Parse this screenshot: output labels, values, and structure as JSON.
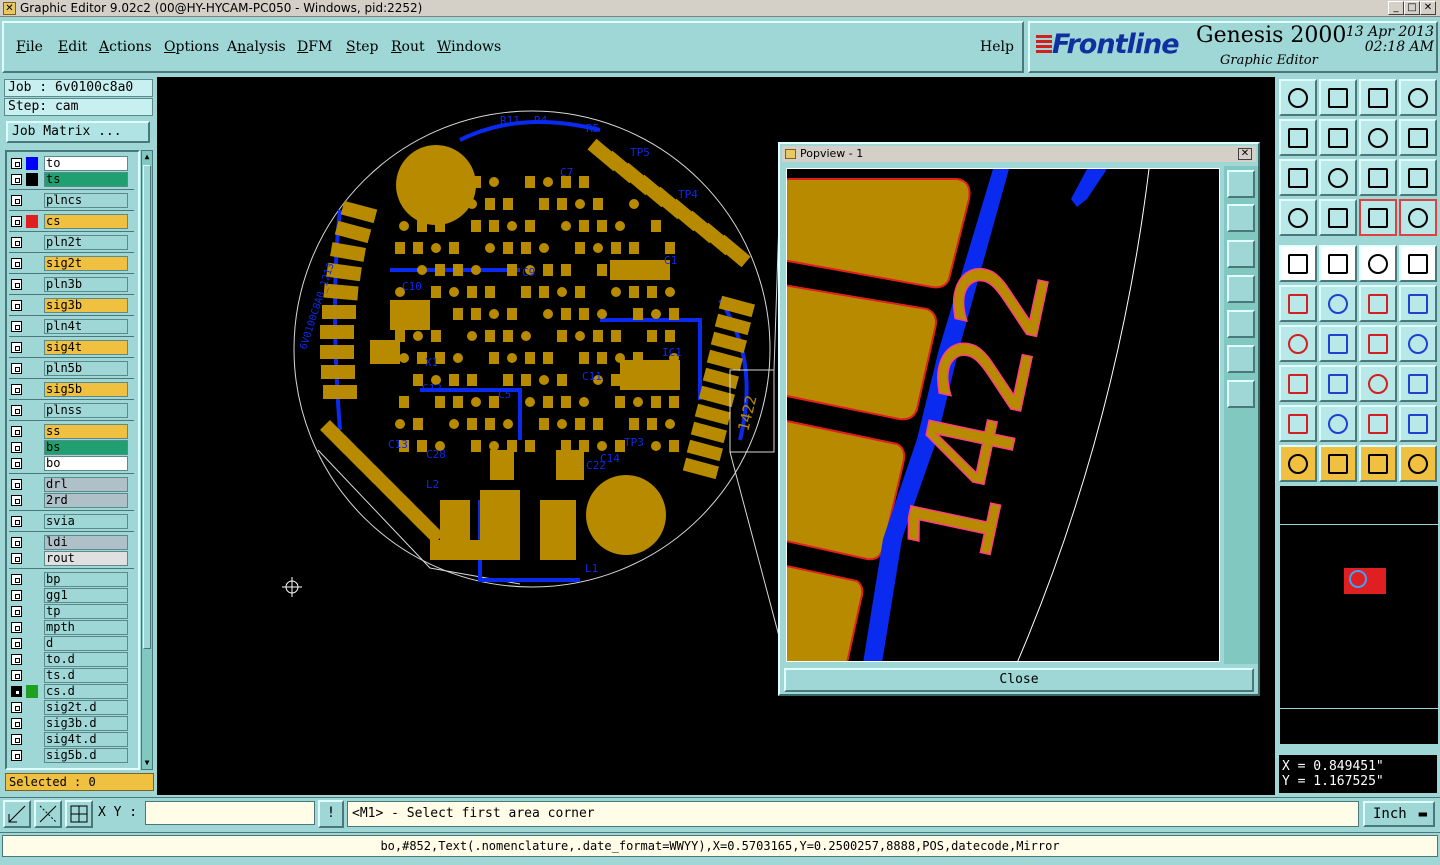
{
  "window": {
    "title": "Graphic Editor 9.02c2 (00@HY-HYCAM-PC050 - Windows, pid:2252)",
    "minimize": "_",
    "maximize": "□",
    "close": "✕"
  },
  "menu": {
    "items": [
      {
        "pre": "",
        "u": "F",
        "post": "ile"
      },
      {
        "pre": "",
        "u": "E",
        "post": "dit"
      },
      {
        "pre": "",
        "u": "A",
        "post": "ctions"
      },
      {
        "pre": "",
        "u": "O",
        "post": "ptions"
      },
      {
        "pre": "A",
        "u": "n",
        "post": "alysis"
      },
      {
        "pre": "",
        "u": "D",
        "post": "FM"
      },
      {
        "pre": "",
        "u": "S",
        "post": "tep"
      },
      {
        "pre": "",
        "u": "R",
        "post": "out"
      },
      {
        "pre": "",
        "u": "W",
        "post": "indows"
      }
    ],
    "help": "Help"
  },
  "brand": {
    "logo": "Frontline",
    "product": "Genesis 2000",
    "subtitle": "Graphic Editor",
    "date": "13 Apr 2013",
    "time": "02:18 AM"
  },
  "job": {
    "job_line": "Job : 6v0100c8a0",
    "step_line": "Step: cam",
    "matrix_button": "Job Matrix ..."
  },
  "layers": [
    {
      "name": "to",
      "color": "#ffffff",
      "swatch": "#0000ff",
      "on": false
    },
    {
      "name": "ts",
      "color": "#20a070",
      "swatch": "#000000",
      "on": false
    },
    {
      "name": "plncs",
      "color": "#9fd6d6",
      "swatch": "",
      "on": false
    },
    {
      "name": "cs",
      "color": "#f0c040",
      "swatch": "#e02020",
      "on": false
    },
    {
      "name": "pln2t",
      "color": "#9fd6d6",
      "swatch": "",
      "on": false
    },
    {
      "name": "sig2t",
      "color": "#f0c040",
      "swatch": "",
      "on": false
    },
    {
      "name": "pln3b",
      "color": "#9fd6d6",
      "swatch": "",
      "on": false
    },
    {
      "name": "sig3b",
      "color": "#f0c040",
      "swatch": "",
      "on": false
    },
    {
      "name": "pln4t",
      "color": "#9fd6d6",
      "swatch": "",
      "on": false
    },
    {
      "name": "sig4t",
      "color": "#f0c040",
      "swatch": "",
      "on": false
    },
    {
      "name": "pln5b",
      "color": "#9fd6d6",
      "swatch": "",
      "on": false
    },
    {
      "name": "sig5b",
      "color": "#f0c040",
      "swatch": "",
      "on": false
    },
    {
      "name": "plnss",
      "color": "#9fd6d6",
      "swatch": "",
      "on": false
    },
    {
      "name": "ss",
      "color": "#f0c040",
      "swatch": "",
      "on": false
    },
    {
      "name": "bs",
      "color": "#20a070",
      "swatch": "",
      "on": false
    },
    {
      "name": "bo",
      "color": "#ffffff",
      "swatch": "",
      "on": false
    },
    {
      "name": "drl",
      "color": "#b0c0c8",
      "swatch": "",
      "on": false
    },
    {
      "name": "2rd",
      "color": "#b0c0c8",
      "swatch": "",
      "on": false
    },
    {
      "name": "svia",
      "color": "#9fd6d6",
      "swatch": "",
      "on": false
    },
    {
      "name": "ldi",
      "color": "#b0c0c8",
      "swatch": "",
      "on": false
    },
    {
      "name": "rout",
      "color": "#e0e0e0",
      "swatch": "",
      "on": false
    },
    {
      "name": "bp",
      "color": "#9fd6d6",
      "swatch": "",
      "on": false
    },
    {
      "name": "gg1",
      "color": "#9fd6d6",
      "swatch": "",
      "on": false
    },
    {
      "name": "tp",
      "color": "#9fd6d6",
      "swatch": "",
      "on": false
    },
    {
      "name": "mpth",
      "color": "#9fd6d6",
      "swatch": "",
      "on": false
    },
    {
      "name": "d",
      "color": "#9fd6d6",
      "swatch": "",
      "on": false
    },
    {
      "name": "to.d",
      "color": "#9fd6d6",
      "swatch": "",
      "on": false
    },
    {
      "name": "ts.d",
      "color": "#9fd6d6",
      "swatch": "",
      "on": false
    },
    {
      "name": "cs.d",
      "color": "#9fd6d6",
      "swatch": "#20a020",
      "on": true
    },
    {
      "name": "sig2t.d",
      "color": "#9fd6d6",
      "swatch": "",
      "on": false
    },
    {
      "name": "sig3b.d",
      "color": "#9fd6d6",
      "swatch": "",
      "on": false
    },
    {
      "name": "sig4t.d",
      "color": "#9fd6d6",
      "swatch": "",
      "on": false
    },
    {
      "name": "sig5b.d",
      "color": "#9fd6d6",
      "swatch": "",
      "on": false
    }
  ],
  "selected": "Selected : 0",
  "popview": {
    "title": "Popview - 1",
    "close_label": "Close",
    "text": "1422"
  },
  "board_labels": [
    "C1",
    "C5",
    "C7",
    "C9",
    "C10",
    "C11",
    "C12",
    "C13",
    "C14",
    "C22",
    "C28",
    "IC1",
    "L1",
    "L2",
    "X1",
    "R4",
    "R5",
    "R11",
    "TP3",
    "TP4",
    "TP5",
    "1422",
    "6V0100C8A0_1213"
  ],
  "coords": {
    "x": "X = 0.849451\"",
    "y": "Y = 1.167525\""
  },
  "xy_label": "X Y :",
  "xy_value": "",
  "prompt": "<M1> - Select first area corner",
  "units": "Inch",
  "status": "bo,#852,Text(.nomenclature,.date_format=WWYY),X=0.5703165,Y=0.2500257,8888,POS,datecode,Mirror",
  "colors": {
    "copper": "#b88a00",
    "trace_blue": "#0a2af0",
    "panel": "#9fd6d6",
    "yellow_btn": "#f0c040"
  }
}
